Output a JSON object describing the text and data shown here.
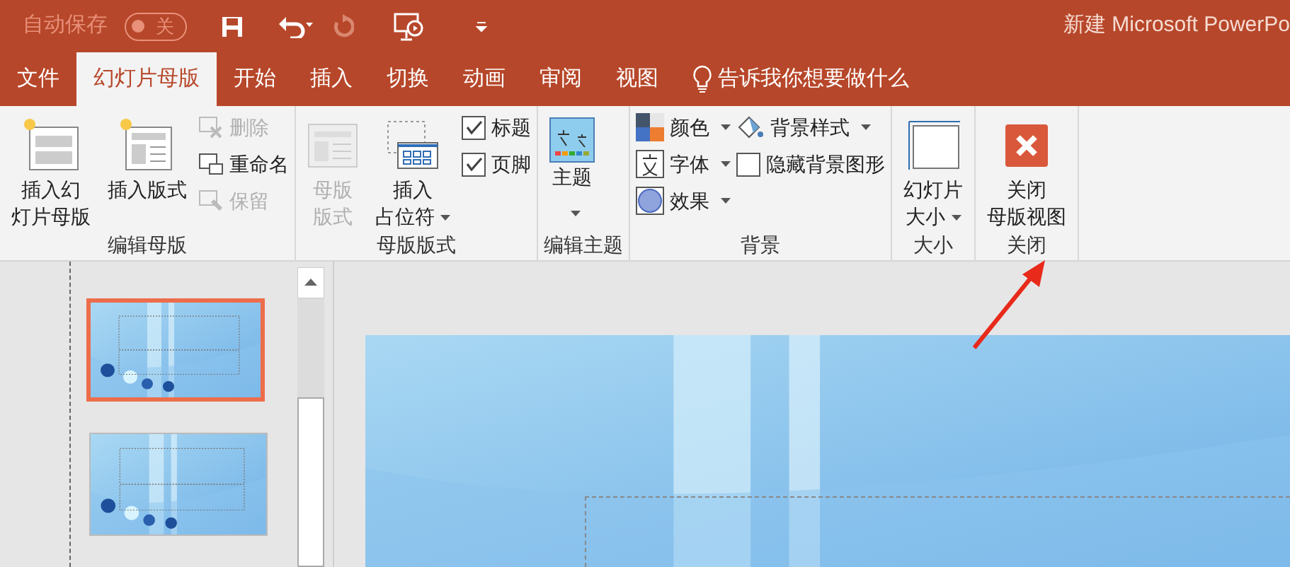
{
  "title_bar": {
    "autosave_label": "自动保存",
    "autosave_toggle": {
      "label": "关",
      "on": false
    },
    "title": "新建 Microsoft PowerPo"
  },
  "tabs": [
    {
      "label": "文件",
      "selected": false
    },
    {
      "label": "幻灯片母版",
      "selected": true
    },
    {
      "label": "开始",
      "selected": false
    },
    {
      "label": "插入",
      "selected": false
    },
    {
      "label": "切换",
      "selected": false
    },
    {
      "label": "动画",
      "selected": false
    },
    {
      "label": "审阅",
      "selected": false
    },
    {
      "label": "视图",
      "selected": false
    }
  ],
  "tell_me": "告诉我你想要做什么",
  "ribbon_groups": [
    {
      "title": "编辑母版",
      "columns": [
        [
          {
            "kind": "large",
            "lines": [
              "插入幻",
              "灯片母版"
            ],
            "disabled": false,
            "dropdown": false
          }
        ],
        [
          {
            "kind": "large",
            "lines": [
              "插入版式"
            ],
            "disabled": false,
            "dropdown": false
          }
        ],
        [
          {
            "kind": "small",
            "label": "删除",
            "disabled": true,
            "dropdown": false
          },
          {
            "kind": "small",
            "label": "重命名",
            "disabled": false,
            "dropdown": false
          },
          {
            "kind": "small",
            "label": "保留",
            "disabled": true,
            "dropdown": false
          }
        ]
      ]
    },
    {
      "title": "母版版式",
      "columns": [
        [
          {
            "kind": "large",
            "lines": [
              "母版",
              "版式"
            ],
            "disabled": true,
            "dropdown": false
          }
        ],
        [
          {
            "kind": "large",
            "lines": [
              "插入",
              "占位符"
            ],
            "disabled": false,
            "dropdown": true
          }
        ],
        [
          {
            "kind": "checkbox",
            "label": "标题",
            "checked": true
          },
          {
            "kind": "checkbox",
            "label": "页脚",
            "checked": true
          }
        ]
      ]
    },
    {
      "title": "编辑主题",
      "columns": [
        [
          {
            "kind": "large",
            "lines": [
              "主题"
            ],
            "disabled": false,
            "dropdown": true
          }
        ]
      ]
    },
    {
      "title": "背景",
      "columns": [
        [
          {
            "kind": "small",
            "label": "颜色",
            "disabled": false,
            "dropdown": true
          },
          {
            "kind": "small",
            "label": "字体",
            "disabled": false,
            "dropdown": true
          },
          {
            "kind": "small",
            "label": "效果",
            "disabled": false,
            "dropdown": true
          }
        ],
        [
          {
            "kind": "small",
            "label": "背景样式",
            "disabled": false,
            "dropdown": true
          },
          {
            "kind": "checkbox",
            "label": "隐藏背景图形",
            "checked": false
          }
        ]
      ]
    },
    {
      "title": "大小",
      "columns": [
        [
          {
            "kind": "large",
            "lines": [
              "幻灯片",
              "大小"
            ],
            "disabled": false,
            "dropdown": true
          }
        ]
      ]
    },
    {
      "title": "关闭",
      "columns": [
        [
          {
            "kind": "large",
            "lines": [
              "关闭",
              "母版视图"
            ],
            "disabled": false,
            "dropdown": false
          }
        ]
      ]
    }
  ],
  "slides": [
    {
      "selected": true
    },
    {
      "selected": false
    }
  ]
}
